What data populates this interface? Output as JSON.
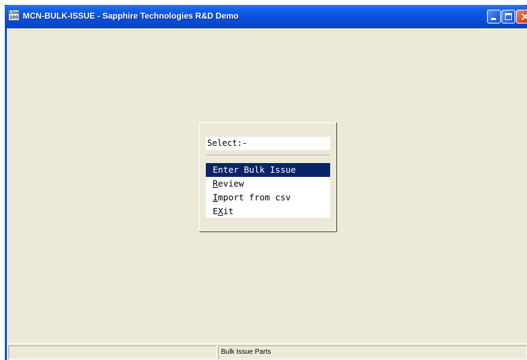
{
  "window": {
    "icon_text": "Line 100",
    "title": "MCN-BULK-ISSUE - Sapphire Technologies R&D Demo"
  },
  "dialog": {
    "select_label": "Select:-",
    "menu": [
      {
        "pre": "Enter Bulk Issue",
        "key": "",
        "post": "",
        "selected": true
      },
      {
        "pre": "",
        "key": "R",
        "post": "eview",
        "selected": false
      },
      {
        "pre": "",
        "key": "I",
        "post": "mport from csv",
        "selected": false
      },
      {
        "pre": "E",
        "key": "X",
        "post": "it",
        "selected": false
      }
    ]
  },
  "statusbar": {
    "pane1": "",
    "pane2": "Bulk Issue Parts"
  },
  "colors": {
    "titlebar": "#0a4fdc",
    "client_bg": "#ece9d8",
    "menu_highlight": "#0a246a"
  }
}
